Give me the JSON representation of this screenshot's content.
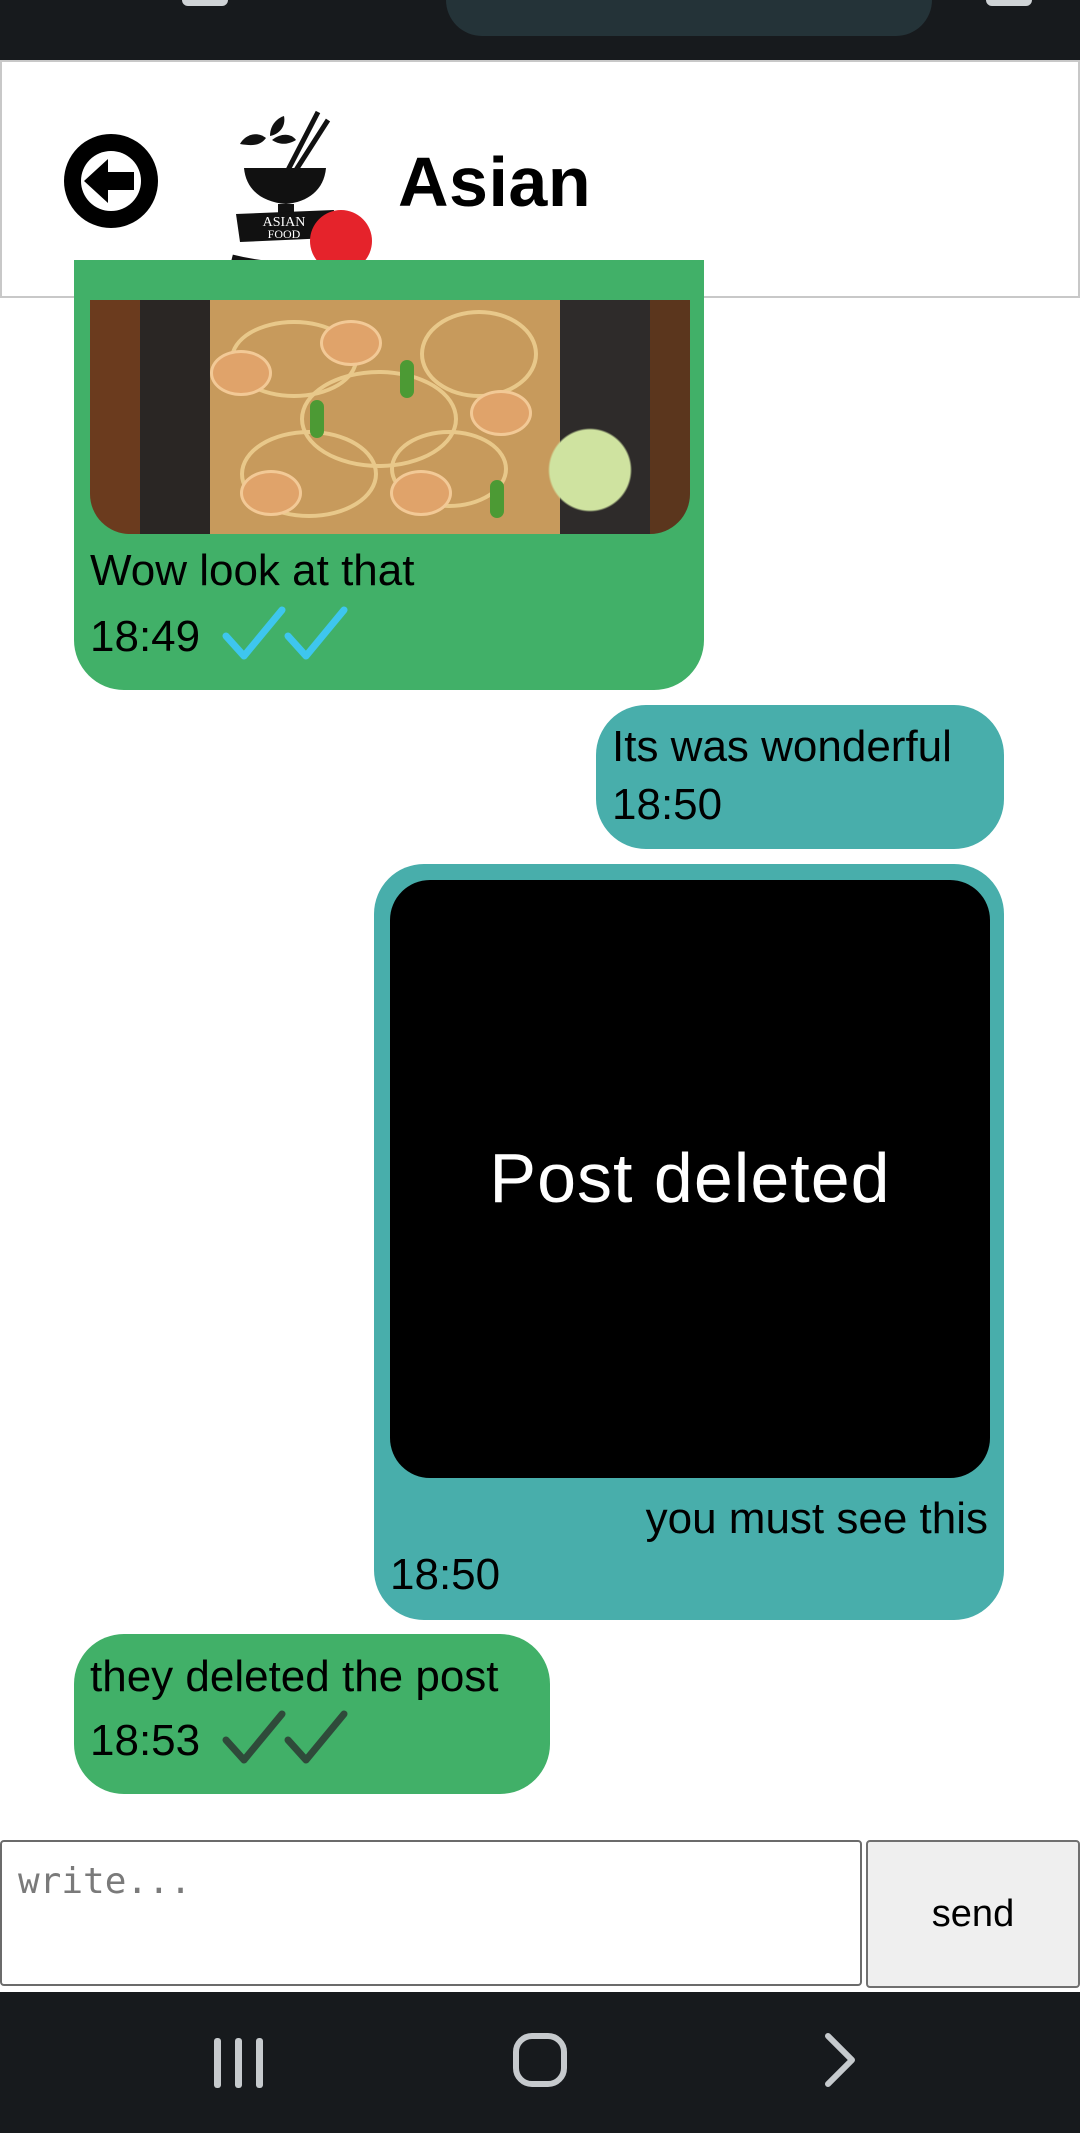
{
  "header": {
    "title": "Asian",
    "logo_text_top": "ASIAN",
    "logo_text_bottom": "FOOD"
  },
  "messages": [
    {
      "direction": "incoming",
      "has_image": true,
      "text": "Wow look at that",
      "time": "18:49",
      "status": "read"
    },
    {
      "direction": "outgoing",
      "text": "Its was wonderful",
      "time": "18:50"
    },
    {
      "direction": "outgoing",
      "has_image": true,
      "image_overlay": "Post deleted",
      "text": "you must see this",
      "time": "18:50"
    },
    {
      "direction": "incoming",
      "text": "they deleted the post",
      "time": "18:53",
      "status": "delivered"
    }
  ],
  "composer": {
    "placeholder": "write...",
    "send_label": "send"
  },
  "colors": {
    "incoming_bubble": "#41b068",
    "outgoing_bubble": "#48aeab",
    "read_check": "#3ec6ee",
    "delivered_check": "#2f4a3a"
  }
}
